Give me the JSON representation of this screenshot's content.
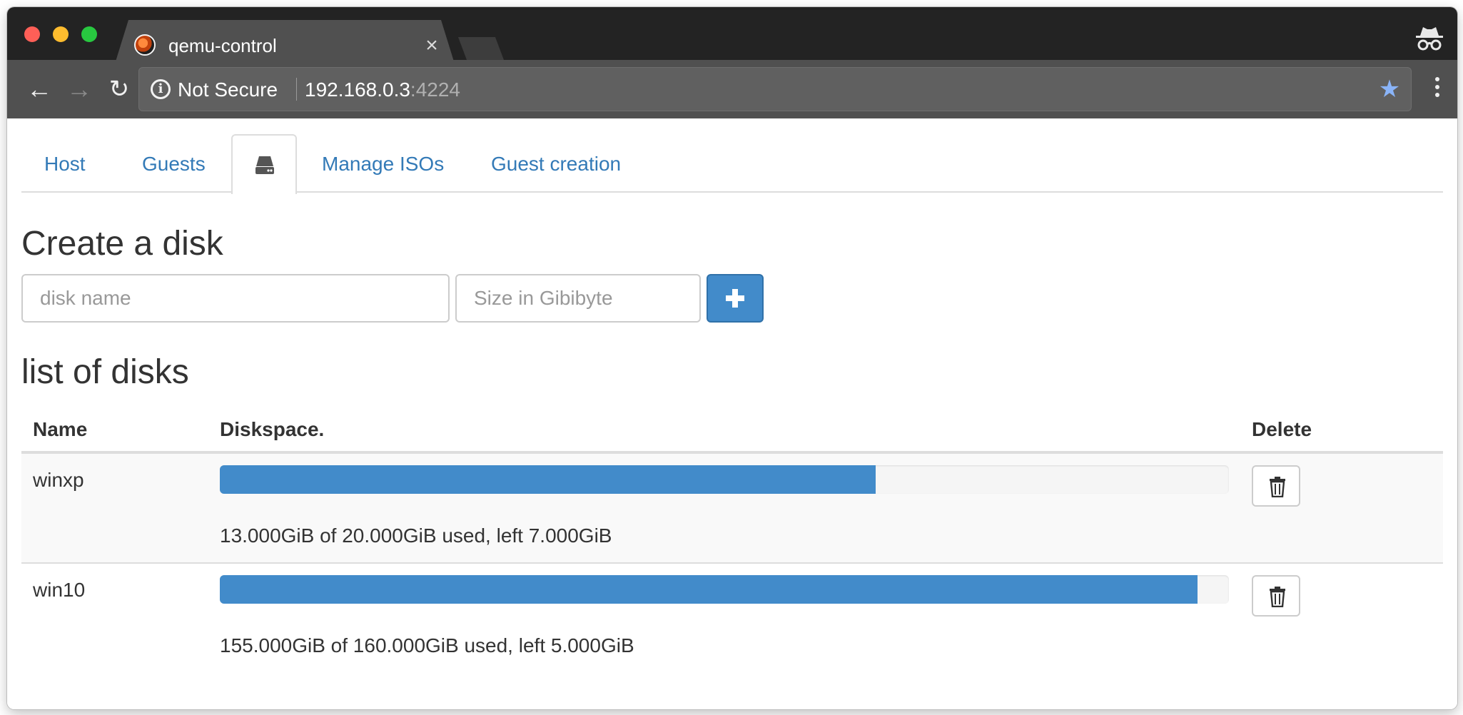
{
  "browser": {
    "tab_title": "qemu-control",
    "security_label": "Not Secure",
    "url_host": "192.168.0.3",
    "url_port": ":4224"
  },
  "nav": {
    "tabs": [
      {
        "label": "Host"
      },
      {
        "label": "Guests"
      },
      {
        "label": "",
        "icon": "hdd-icon",
        "active": true
      },
      {
        "label": "Manage ISOs"
      },
      {
        "label": "Guest creation"
      }
    ]
  },
  "create": {
    "heading": "Create a disk",
    "name_placeholder": "disk name",
    "size_placeholder": "Size in Gibibyte",
    "add_icon": "plus-icon"
  },
  "list": {
    "heading": "list of disks",
    "columns": [
      "Name",
      "Diskspace.",
      "Delete"
    ],
    "rows": [
      {
        "name": "winxp",
        "used_fraction": 0.65,
        "usage": "13.000GiB of 20.000GiB used, left 7.000GiB"
      },
      {
        "name": "win10",
        "used_fraction": 0.969,
        "usage": "155.000GiB of 160.000GiB used, left 5.000GiB"
      }
    ]
  },
  "colors": {
    "primary": "#428bca",
    "link": "#337ab7",
    "text": "#333333"
  }
}
